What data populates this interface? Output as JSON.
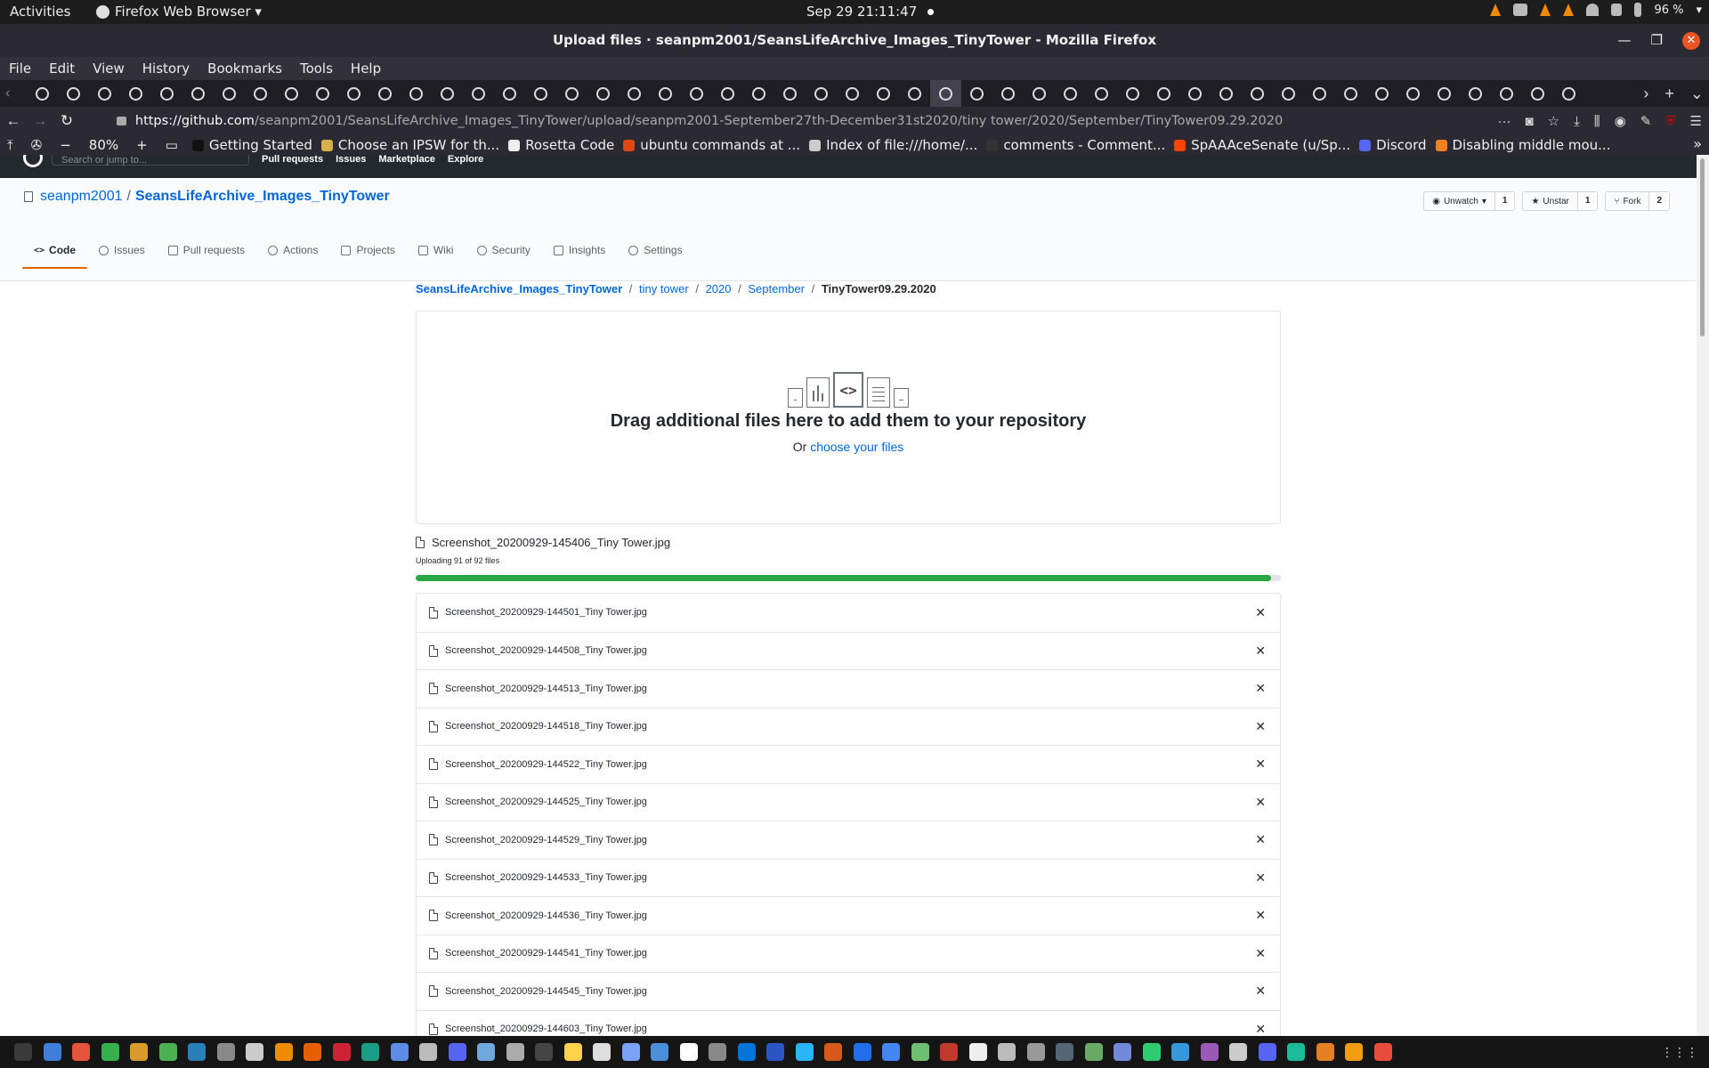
{
  "system": {
    "activities": "Activities",
    "app_menu": "Firefox Web Browser ▾",
    "clock": "Sep 29  21:11:47",
    "battery": "96 %"
  },
  "window": {
    "title": "Upload files · seanpm2001/SeansLifeArchive_Images_TinyTower - Mozilla Firefox"
  },
  "menu": [
    "File",
    "Edit",
    "View",
    "History",
    "Bookmarks",
    "Tools",
    "Help"
  ],
  "tabs": {
    "count": 50,
    "active_index": 29
  },
  "url": {
    "host": "https://github.com",
    "path": "/seanpm2001/SeansLifeArchive_Images_TinyTower/upload/seanpm2001-September27th-December31st2020/tiny tower/2020/September/TinyTower09.29.2020"
  },
  "zoom": "80%",
  "bookmarks": [
    {
      "label": "Getting Started",
      "color": "#111111"
    },
    {
      "label": "Choose an IPSW for th...",
      "color": "#d8b04a"
    },
    {
      "label": "Rosetta Code",
      "color": "#eeeeee"
    },
    {
      "label": "ubuntu commands at ...",
      "color": "#de4815"
    },
    {
      "label": "Index of file:///home/...",
      "color": "#cccccc"
    },
    {
      "label": "comments - Comment...",
      "color": "#333333"
    },
    {
      "label": "SpAAAceSenate (u/Sp...",
      "color": "#ff4500"
    },
    {
      "label": "Discord",
      "color": "#5865f2"
    },
    {
      "label": "Disabling middle mou...",
      "color": "#f48024"
    }
  ],
  "github": {
    "header": {
      "search_placeholder": "Search or jump to...",
      "nav": [
        "Pull requests",
        "Issues",
        "Marketplace",
        "Explore"
      ]
    },
    "repo": {
      "owner": "seanpm2001",
      "name": "SeansLifeArchive_Images_TinyTower",
      "unwatch": "Unwatch",
      "watch_count": "1",
      "unstar": "Unstar",
      "star_count": "1",
      "fork": "Fork",
      "fork_count": "2"
    },
    "tabs": [
      "Code",
      "Issues",
      "Pull requests",
      "Actions",
      "Projects",
      "Wiki",
      "Security",
      "Insights",
      "Settings"
    ],
    "breadcrumb": {
      "repo": "SeansLifeArchive_Images_TinyTower",
      "parts": [
        "tiny tower",
        "2020",
        "September"
      ],
      "final": "TinyTower09.29.2020"
    },
    "dropzone": {
      "heading": "Drag additional files here to add them to your repository",
      "prefix": "Or",
      "link": "choose your files"
    },
    "upload": {
      "current_file": "Screenshot_20200929-145406_Tiny Tower.jpg",
      "status": "Uploading 91 of 92 files",
      "progress": 0.989
    },
    "files": [
      "Screenshot_20200929-144501_Tiny Tower.jpg",
      "Screenshot_20200929-144508_Tiny Tower.jpg",
      "Screenshot_20200929-144513_Tiny Tower.jpg",
      "Screenshot_20200929-144518_Tiny Tower.jpg",
      "Screenshot_20200929-144522_Tiny Tower.jpg",
      "Screenshot_20200929-144525_Tiny Tower.jpg",
      "Screenshot_20200929-144529_Tiny Tower.jpg",
      "Screenshot_20200929-144533_Tiny Tower.jpg",
      "Screenshot_20200929-144536_Tiny Tower.jpg",
      "Screenshot_20200929-144541_Tiny Tower.jpg",
      "Screenshot_20200929-144545_Tiny Tower.jpg",
      "Screenshot_20200929-144603_Tiny Tower.jpg"
    ]
  },
  "dock_colors": [
    "#3a3a3a",
    "#3f7fd8",
    "#e5533d",
    "#35b04a",
    "#d99a2b",
    "#4caf50",
    "#2980b9",
    "#888888",
    "#cccccc",
    "#f08a00",
    "#e66000",
    "#cc2233",
    "#1b9c85",
    "#5c8de6",
    "#bbbbbb",
    "#5865f2",
    "#6fa8dc",
    "#aaaaaa",
    "#444444",
    "#ffd24c",
    "#dddddd",
    "#7aa2f7",
    "#4a90d9",
    "#ffffff",
    "#888888",
    "#0074d9",
    "#2a56c6",
    "#29b6f6",
    "#d85a1a",
    "#1f6feb",
    "#4286f4",
    "#6fbf73",
    "#c0392b",
    "#eeeeee",
    "#bbbbbb",
    "#999999",
    "#556677",
    "#66aa66",
    "#7289da",
    "#2ecc71",
    "#3498db",
    "#9b59b6",
    "#cccccc",
    "#5865f2",
    "#1abc9c",
    "#e67e22",
    "#f39c12",
    "#e74c3c"
  ]
}
